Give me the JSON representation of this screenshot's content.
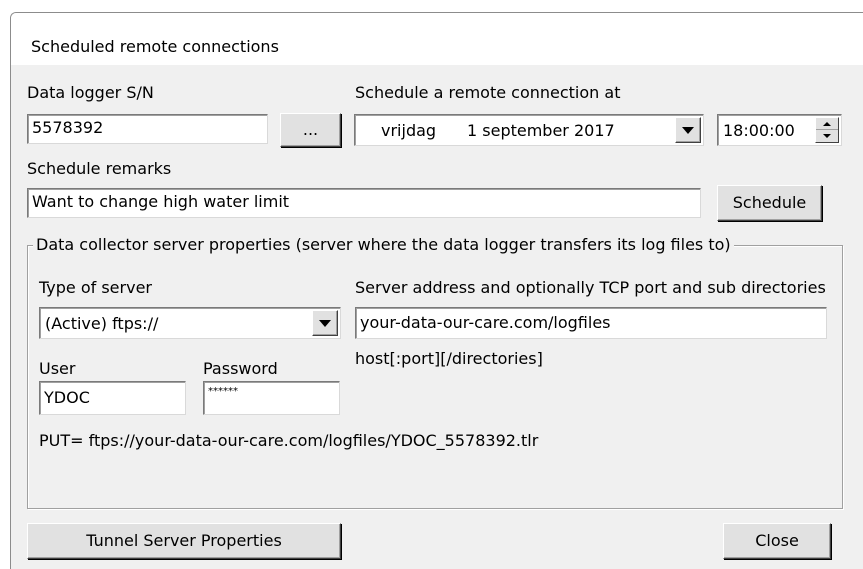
{
  "window": {
    "title": "Scheduled remote connections"
  },
  "logger": {
    "sn_label": "Data logger S/N",
    "sn_value": "5578392",
    "browse_label": "..."
  },
  "schedule": {
    "label": "Schedule a remote connection at",
    "day": "vrijdag",
    "date": "1 september 2017",
    "time": "18:00:00",
    "remarks_label": "Schedule remarks",
    "remarks_value": "Want to change high water limit",
    "schedule_button": "Schedule"
  },
  "server": {
    "group_label": "Data collector server properties (server where the data logger transfers its log files to)",
    "type_label": "Type of server",
    "type_value": "(Active) ftps://",
    "address_label": "Server address and optionally TCP port and sub directories",
    "address_value": "your-data-our-care.com/logfiles",
    "address_hint": "host[:port][/directories]",
    "user_label": "User",
    "user_value": "YDOC",
    "password_label": "Password",
    "password_value": "******",
    "put_text": "PUT= ftps://your-data-our-care.com/logfiles/YDOC_5578392.tlr"
  },
  "footer": {
    "tunnel_button": "Tunnel Server Properties",
    "close_button": "Close"
  }
}
